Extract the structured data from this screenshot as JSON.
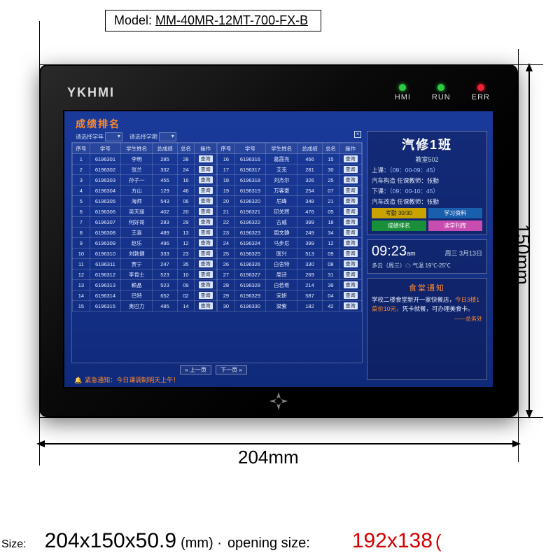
{
  "model": {
    "label": "Model:",
    "value": "MM-40MR-12MT-700-FX-B"
  },
  "brand": "YKHMI",
  "leds": {
    "hmi": "HMI",
    "run": "RUN",
    "err": "ERR"
  },
  "dimensions": {
    "width": "204mm",
    "height": "150mm"
  },
  "spec": {
    "size_label": "Size:",
    "size_value": "204x150x50.9",
    "size_unit": "(mm) ·",
    "opening_label": "opening size:",
    "opening_value": "192x138",
    "opening_paren": "("
  },
  "screen": {
    "title": "成绩排名",
    "filter1_label": "请选择学年",
    "filter2_label": "请选择学期",
    "close": "×",
    "headers": [
      "序号",
      "学号",
      "学生姓名",
      "总成绩",
      "总名",
      "操作"
    ],
    "rows_left": [
      [
        "1",
        "6196301",
        "李明",
        "285",
        "28",
        "查询"
      ],
      [
        "2",
        "6196302",
        "张兰",
        "332",
        "24",
        "查询"
      ],
      [
        "3",
        "6196303",
        "孙子一",
        "455",
        "16",
        "查询"
      ],
      [
        "4",
        "6196304",
        "方山",
        "129",
        "46",
        "查询"
      ],
      [
        "5",
        "6196305",
        "海师",
        "543",
        "06",
        "查询"
      ],
      [
        "6",
        "6196306",
        "吴天丽",
        "402",
        "20",
        "查询"
      ],
      [
        "7",
        "6196307",
        "何好哥",
        "283",
        "29",
        "查询"
      ],
      [
        "8",
        "6196308",
        "王喜",
        "489",
        "13",
        "查询"
      ],
      [
        "9",
        "6196309",
        "赵乐",
        "496",
        "12",
        "查询"
      ],
      [
        "10",
        "6196310",
        "刘勃健",
        "333",
        "23",
        "查询"
      ],
      [
        "11",
        "6196311",
        "贾宁",
        "247",
        "35",
        "查询"
      ],
      [
        "12",
        "6196312",
        "李肯士",
        "523",
        "10",
        "查询"
      ],
      [
        "13",
        "6196313",
        "赖晶",
        "523",
        "09",
        "查询"
      ],
      [
        "14",
        "6196314",
        "巴特",
        "652",
        "02",
        "查询"
      ],
      [
        "15",
        "6196315",
        "奥巴力",
        "485",
        "14",
        "查询"
      ]
    ],
    "rows_right": [
      [
        "16",
        "6196316",
        "葛霞亮",
        "456",
        "15",
        "查询"
      ],
      [
        "17",
        "6196317",
        "艾克",
        "281",
        "30",
        "查询"
      ],
      [
        "18",
        "6196318",
        "刘杰尔",
        "326",
        "25",
        "查询"
      ],
      [
        "19",
        "6196319",
        "万客豪",
        "254",
        "07",
        "查询"
      ],
      [
        "20",
        "6196320",
        "尼峰",
        "348",
        "21",
        "查询"
      ],
      [
        "21",
        "6196321",
        "印关辉",
        "476",
        "05",
        "查询"
      ],
      [
        "22",
        "6196322",
        "古威",
        "399",
        "18",
        "查询"
      ],
      [
        "23",
        "6196323",
        "周文静",
        "249",
        "34",
        "查询"
      ],
      [
        "24",
        "6196324",
        "马步尼",
        "399",
        "12",
        "查询"
      ],
      [
        "25",
        "6196325",
        "医兴",
        "513",
        "09",
        "查询"
      ],
      [
        "26",
        "6196326",
        "白舍特",
        "330",
        "08",
        "查询"
      ],
      [
        "27",
        "6196327",
        "周诗",
        "269",
        "31",
        "查询"
      ],
      [
        "28",
        "6196328",
        "白若希",
        "214",
        "39",
        "查询"
      ],
      [
        "29",
        "6196329",
        "宋妍",
        "587",
        "04",
        "查询"
      ],
      [
        "30",
        "6196330",
        "梁紫",
        "182",
        "42",
        "查询"
      ]
    ],
    "pager_prev": "« 上一页",
    "pager_next": "下一页 »",
    "alert": "紧急通知：今日课调制明天上午！"
  },
  "sidebar": {
    "class_title": "汽修1班",
    "class_sub": "教室502",
    "sched1_label": "上课：",
    "sched1_time": "（09：00-09：45）",
    "sched2_label": "汽车构造 任课教师：张勤",
    "sched3_label": "下课：",
    "sched3_time": "（09：00-10：45）",
    "sched4_label": "汽车改造 任课教师：张勤",
    "chips": [
      "考勤 30/30",
      "学习资料",
      "成绩排名",
      "读学刊库"
    ],
    "clock_h": "09:23",
    "clock_s": "am",
    "date": "周三 3月13日",
    "weather": "多云（周三）☁  气温 19℃-25℃",
    "notice_title": "食堂通知",
    "notice_body_1": "学校二楼食堂新开一家快餐店，",
    "notice_body_hl": "今日3楼1菜价10元，",
    "notice_body_2": "凭卡就餐，可办理美食卡。",
    "notice_sig": "——总务处"
  }
}
